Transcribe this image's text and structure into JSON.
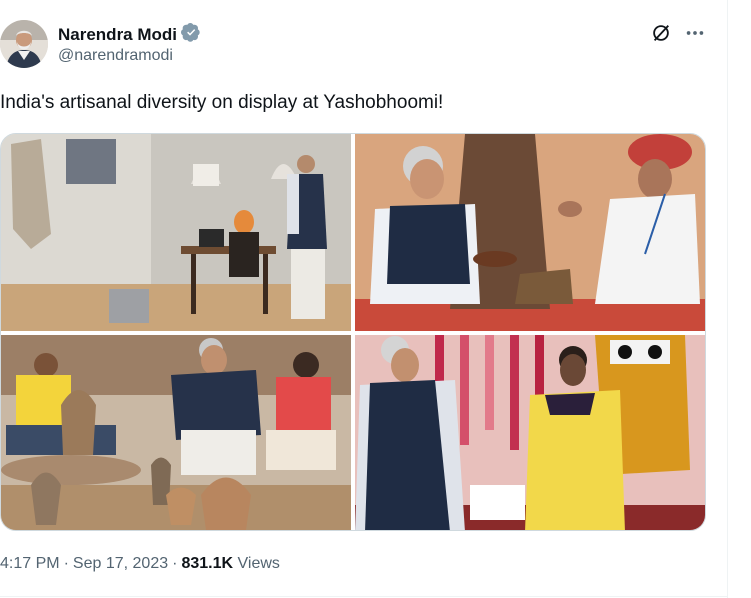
{
  "author": {
    "name": "Narendra Modi",
    "handle": "@narendramodi",
    "verified": true,
    "verified_color": "#829aab"
  },
  "header_icons": [
    "grok-icon",
    "more-options-icon"
  ],
  "tweet": {
    "text": "India's artisanal diversity on display at Yashobhoomi!"
  },
  "media": {
    "count": 4,
    "layout": "2x2 grid"
  },
  "meta": {
    "time": "4:17 PM",
    "separator": "·",
    "date": "Sep 17, 2023",
    "views_count": "831.1K",
    "views_label": "Views"
  },
  "colors": {
    "text_primary": "#0f1419",
    "text_secondary": "#536471",
    "border": "#cfd9de"
  }
}
